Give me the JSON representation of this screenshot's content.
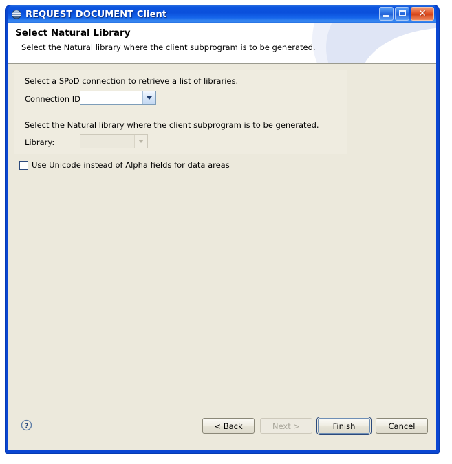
{
  "window": {
    "title": "REQUEST DOCUMENT Client",
    "icon": "globe-icon",
    "minimize_label": "",
    "maximize_label": "",
    "close_label": "✕"
  },
  "header": {
    "title": "Select Natural Library",
    "subtitle": "Select the Natural library where the client subprogram is to be generated."
  },
  "form": {
    "connection_intro": "Select a SPoD connection to retrieve a list of libraries.",
    "connection_label": "Connection ID:",
    "connection_value": "",
    "library_intro": "Select the Natural library where the client subprogram is to be generated.",
    "library_label": "Library:",
    "library_value": "",
    "unicode_checkbox_label": "Use Unicode instead of Alpha fields for data areas",
    "unicode_checked": false
  },
  "footer": {
    "help_glyph": "?",
    "buttons": [
      {
        "id": "back",
        "prefix": "< ",
        "accel": "B",
        "suffix": "ack",
        "state": "enabled"
      },
      {
        "id": "next",
        "prefix": "",
        "accel": "N",
        "suffix": "ext >",
        "state": "disabled"
      },
      {
        "id": "finish",
        "prefix": "",
        "accel": "F",
        "suffix": "inish",
        "state": "default"
      },
      {
        "id": "cancel",
        "prefix": "",
        "accel": "C",
        "suffix": "ancel",
        "state": "enabled"
      }
    ],
    "back_label": "< Back",
    "next_label": "Next >",
    "finish_label": "Finish",
    "cancel_label": "Cancel"
  },
  "colors": {
    "title_blue": "#0A4FDB",
    "body_beige": "#ECE9DC",
    "panel_beige": "#EFECE0",
    "accent_border": "#2C4A7C",
    "close_red": "#D44317"
  }
}
